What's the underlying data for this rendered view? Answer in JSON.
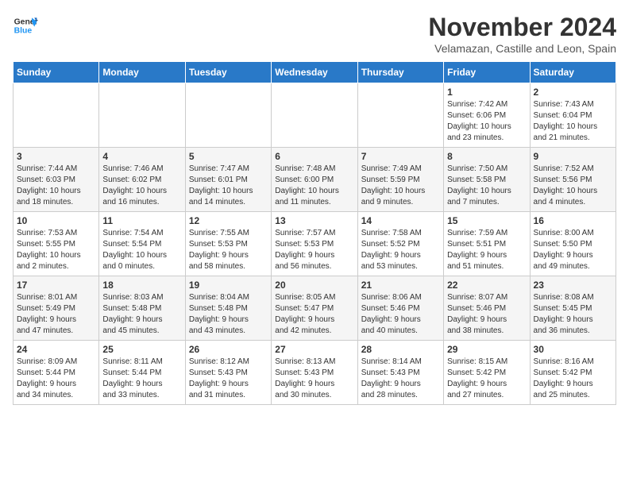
{
  "logo": {
    "line1": "General",
    "line2": "Blue"
  },
  "title": "November 2024",
  "subtitle": "Velamazan, Castille and Leon, Spain",
  "weekdays": [
    "Sunday",
    "Monday",
    "Tuesday",
    "Wednesday",
    "Thursday",
    "Friday",
    "Saturday"
  ],
  "weeks": [
    [
      {
        "day": "",
        "info": ""
      },
      {
        "day": "",
        "info": ""
      },
      {
        "day": "",
        "info": ""
      },
      {
        "day": "",
        "info": ""
      },
      {
        "day": "",
        "info": ""
      },
      {
        "day": "1",
        "info": "Sunrise: 7:42 AM\nSunset: 6:06 PM\nDaylight: 10 hours\nand 23 minutes."
      },
      {
        "day": "2",
        "info": "Sunrise: 7:43 AM\nSunset: 6:04 PM\nDaylight: 10 hours\nand 21 minutes."
      }
    ],
    [
      {
        "day": "3",
        "info": "Sunrise: 7:44 AM\nSunset: 6:03 PM\nDaylight: 10 hours\nand 18 minutes."
      },
      {
        "day": "4",
        "info": "Sunrise: 7:46 AM\nSunset: 6:02 PM\nDaylight: 10 hours\nand 16 minutes."
      },
      {
        "day": "5",
        "info": "Sunrise: 7:47 AM\nSunset: 6:01 PM\nDaylight: 10 hours\nand 14 minutes."
      },
      {
        "day": "6",
        "info": "Sunrise: 7:48 AM\nSunset: 6:00 PM\nDaylight: 10 hours\nand 11 minutes."
      },
      {
        "day": "7",
        "info": "Sunrise: 7:49 AM\nSunset: 5:59 PM\nDaylight: 10 hours\nand 9 minutes."
      },
      {
        "day": "8",
        "info": "Sunrise: 7:50 AM\nSunset: 5:58 PM\nDaylight: 10 hours\nand 7 minutes."
      },
      {
        "day": "9",
        "info": "Sunrise: 7:52 AM\nSunset: 5:56 PM\nDaylight: 10 hours\nand 4 minutes."
      }
    ],
    [
      {
        "day": "10",
        "info": "Sunrise: 7:53 AM\nSunset: 5:55 PM\nDaylight: 10 hours\nand 2 minutes."
      },
      {
        "day": "11",
        "info": "Sunrise: 7:54 AM\nSunset: 5:54 PM\nDaylight: 10 hours\nand 0 minutes."
      },
      {
        "day": "12",
        "info": "Sunrise: 7:55 AM\nSunset: 5:53 PM\nDaylight: 9 hours\nand 58 minutes."
      },
      {
        "day": "13",
        "info": "Sunrise: 7:57 AM\nSunset: 5:53 PM\nDaylight: 9 hours\nand 56 minutes."
      },
      {
        "day": "14",
        "info": "Sunrise: 7:58 AM\nSunset: 5:52 PM\nDaylight: 9 hours\nand 53 minutes."
      },
      {
        "day": "15",
        "info": "Sunrise: 7:59 AM\nSunset: 5:51 PM\nDaylight: 9 hours\nand 51 minutes."
      },
      {
        "day": "16",
        "info": "Sunrise: 8:00 AM\nSunset: 5:50 PM\nDaylight: 9 hours\nand 49 minutes."
      }
    ],
    [
      {
        "day": "17",
        "info": "Sunrise: 8:01 AM\nSunset: 5:49 PM\nDaylight: 9 hours\nand 47 minutes."
      },
      {
        "day": "18",
        "info": "Sunrise: 8:03 AM\nSunset: 5:48 PM\nDaylight: 9 hours\nand 45 minutes."
      },
      {
        "day": "19",
        "info": "Sunrise: 8:04 AM\nSunset: 5:48 PM\nDaylight: 9 hours\nand 43 minutes."
      },
      {
        "day": "20",
        "info": "Sunrise: 8:05 AM\nSunset: 5:47 PM\nDaylight: 9 hours\nand 42 minutes."
      },
      {
        "day": "21",
        "info": "Sunrise: 8:06 AM\nSunset: 5:46 PM\nDaylight: 9 hours\nand 40 minutes."
      },
      {
        "day": "22",
        "info": "Sunrise: 8:07 AM\nSunset: 5:46 PM\nDaylight: 9 hours\nand 38 minutes."
      },
      {
        "day": "23",
        "info": "Sunrise: 8:08 AM\nSunset: 5:45 PM\nDaylight: 9 hours\nand 36 minutes."
      }
    ],
    [
      {
        "day": "24",
        "info": "Sunrise: 8:09 AM\nSunset: 5:44 PM\nDaylight: 9 hours\nand 34 minutes."
      },
      {
        "day": "25",
        "info": "Sunrise: 8:11 AM\nSunset: 5:44 PM\nDaylight: 9 hours\nand 33 minutes."
      },
      {
        "day": "26",
        "info": "Sunrise: 8:12 AM\nSunset: 5:43 PM\nDaylight: 9 hours\nand 31 minutes."
      },
      {
        "day": "27",
        "info": "Sunrise: 8:13 AM\nSunset: 5:43 PM\nDaylight: 9 hours\nand 30 minutes."
      },
      {
        "day": "28",
        "info": "Sunrise: 8:14 AM\nSunset: 5:43 PM\nDaylight: 9 hours\nand 28 minutes."
      },
      {
        "day": "29",
        "info": "Sunrise: 8:15 AM\nSunset: 5:42 PM\nDaylight: 9 hours\nand 27 minutes."
      },
      {
        "day": "30",
        "info": "Sunrise: 8:16 AM\nSunset: 5:42 PM\nDaylight: 9 hours\nand 25 minutes."
      }
    ]
  ]
}
